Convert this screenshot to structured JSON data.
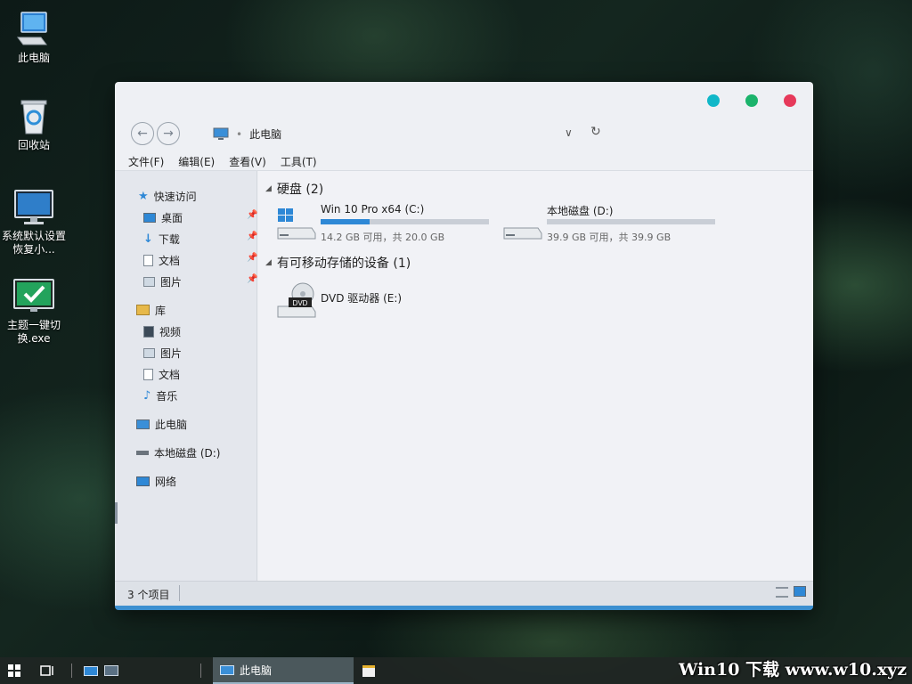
{
  "desktop": {
    "icons": [
      {
        "label": "此电脑"
      },
      {
        "label": "回收站"
      },
      {
        "label": "系统默认设置恢复小..."
      },
      {
        "label": "主题一键切换.exe"
      }
    ]
  },
  "window": {
    "controls": {
      "minimize_color": "#10b7c8",
      "maximize_color": "#1bb36b",
      "close_color": "#e6395a"
    },
    "address": {
      "location": "此电脑"
    },
    "menu": [
      "文件(F)",
      "编辑(E)",
      "查看(V)",
      "工具(T)"
    ],
    "sidebar": {
      "quick_access": "快速访问",
      "quick_items": [
        "桌面",
        "下载",
        "文档",
        "图片"
      ],
      "library": "库",
      "library_items": [
        "视频",
        "图片",
        "文档",
        "音乐"
      ],
      "this_pc": "此电脑",
      "local_disk": "本地磁盘 (D:)",
      "network": "网络"
    },
    "groups": {
      "hard_disks": "硬盘 (2)",
      "removable": "有可移动存储的设备 (1)"
    },
    "drives": [
      {
        "name": "Win 10 Pro x64 (C:)",
        "info": "14.2 GB 可用，共 20.0 GB",
        "used_fraction": 0.29
      },
      {
        "name": "本地磁盘 (D:)",
        "info": "39.9 GB 可用，共 39.9 GB",
        "used_fraction": 0.0
      },
      {
        "name": "DVD 驱动器 (E:)",
        "badge": "DVD"
      }
    ],
    "status": {
      "item_count": "3 个项目"
    }
  },
  "taskbar": {
    "active_app": "此电脑",
    "watermark": "Win10 下载 www.w10.xyz"
  }
}
